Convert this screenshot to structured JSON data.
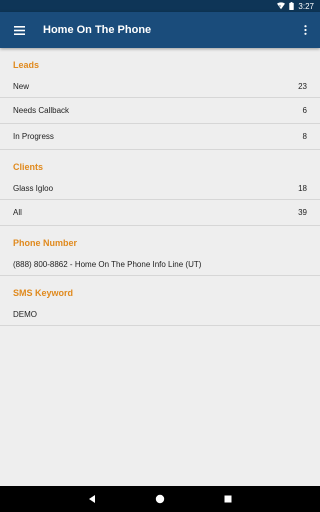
{
  "status_bar": {
    "time": "3:27"
  },
  "app_bar": {
    "title": "Home On The Phone"
  },
  "sections": {
    "leads": {
      "header": "Leads",
      "rows": [
        {
          "label": "New",
          "count": "23"
        },
        {
          "label": "Needs Callback",
          "count": "6"
        },
        {
          "label": "In Progress",
          "count": "8"
        }
      ]
    },
    "clients": {
      "header": "Clients",
      "rows": [
        {
          "label": "Glass Igloo",
          "count": "18"
        },
        {
          "label": "All",
          "count": "39"
        }
      ]
    },
    "phone": {
      "header": "Phone Number",
      "value": "(888) 800-8862 - Home On The Phone Info Line (UT)"
    },
    "sms": {
      "header": "SMS Keyword",
      "value": "DEMO"
    }
  },
  "colors": {
    "app_bar": "#1A4C7B",
    "status_bar": "#0E3557",
    "section_header": "#E08A1E",
    "background": "#EEEEEE"
  },
  "icons": [
    "hamburger-menu-icon",
    "overflow-menu-icon",
    "wifi-icon",
    "battery-icon",
    "back-icon",
    "home-icon",
    "recents-icon"
  ]
}
